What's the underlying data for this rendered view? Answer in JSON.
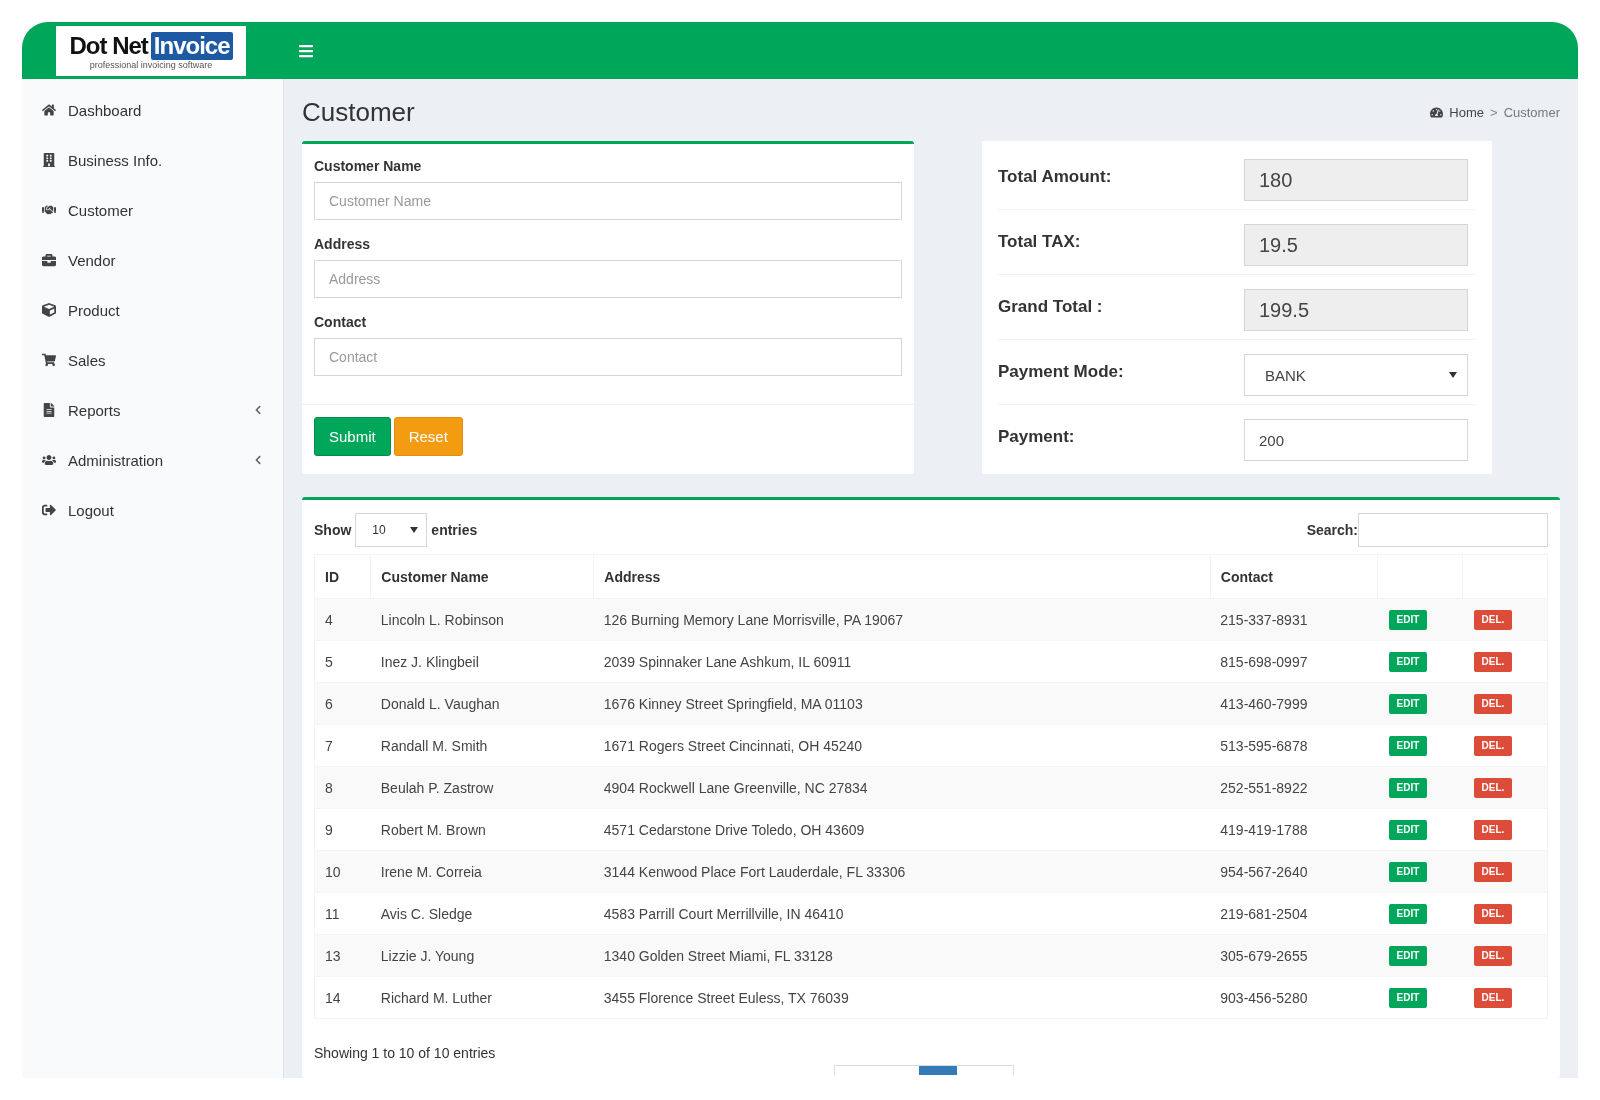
{
  "logo": {
    "brand": "Dot Net",
    "brand_highlight": "Invoice",
    "tagline": "professional invoicing software"
  },
  "sidebar": {
    "items": [
      {
        "label": "Dashboard",
        "submenu": false
      },
      {
        "label": "Business Info.",
        "submenu": false
      },
      {
        "label": "Customer",
        "submenu": false
      },
      {
        "label": "Vendor",
        "submenu": false
      },
      {
        "label": "Product",
        "submenu": false
      },
      {
        "label": "Sales",
        "submenu": false
      },
      {
        "label": "Reports",
        "submenu": true
      },
      {
        "label": "Administration",
        "submenu": true
      },
      {
        "label": "Logout",
        "submenu": false
      }
    ]
  },
  "page_title": "Customer",
  "breadcrumb": [
    "Home",
    "Customer"
  ],
  "breadcrumb_separator": ">",
  "form": {
    "fields": [
      {
        "label": "Customer Name",
        "placeholder": "Customer Name"
      },
      {
        "label": "Address",
        "placeholder": "Address"
      },
      {
        "label": "Contact",
        "placeholder": "Contact"
      }
    ],
    "buttons": [
      {
        "label": "Submit",
        "kind": "primary"
      },
      {
        "label": "Reset",
        "kind": "warning"
      }
    ]
  },
  "totals": [
    {
      "label": "Total Amount:",
      "kind": "readonly",
      "value": "180"
    },
    {
      "label": "Total TAX:",
      "kind": "readonly",
      "value": "19.5"
    },
    {
      "label": "Grand Total :",
      "kind": "readonly",
      "value": "199.5"
    },
    {
      "label": "Payment Mode:",
      "kind": "select",
      "value": "BANK"
    },
    {
      "label": "Payment:",
      "kind": "input",
      "value": "200"
    }
  ],
  "table": {
    "show_label": "Show",
    "page_size": "10",
    "entries_label": "entries",
    "search_label": "Search:",
    "columns": [
      "ID",
      "Customer Name",
      "Address",
      "Contact"
    ],
    "rows": [
      {
        "id": "4",
        "name": "Lincoln L. Robinson",
        "address": "126 Burning Memory Lane Morrisville, PA 19067",
        "contact": "215-337-8931",
        "edit": "EDIT",
        "delete": "DEL."
      },
      {
        "id": "5",
        "name": "Inez J. Klingbeil",
        "address": "2039 Spinnaker Lane Ashkum, IL 60911",
        "contact": "815-698-0997",
        "edit": "EDIT",
        "delete": "DEL."
      },
      {
        "id": "6",
        "name": "Donald L. Vaughan",
        "address": "1676 Kinney Street Springfield, MA 01103",
        "contact": "413-460-7999",
        "edit": "EDIT",
        "delete": "DEL."
      },
      {
        "id": "7",
        "name": "Randall M. Smith",
        "address": "1671 Rogers Street Cincinnati, OH 45240",
        "contact": "513-595-6878",
        "edit": "EDIT",
        "delete": "DEL."
      },
      {
        "id": "8",
        "name": "Beulah P. Zastrow",
        "address": "4904 Rockwell Lane Greenville, NC 27834",
        "contact": "252-551-8922",
        "edit": "EDIT",
        "delete": "DEL."
      },
      {
        "id": "9",
        "name": "Robert M. Brown",
        "address": "4571 Cedarstone Drive Toledo, OH 43609",
        "contact": "419-419-1788",
        "edit": "EDIT",
        "delete": "DEL."
      },
      {
        "id": "10",
        "name": "Irene M. Correia",
        "address": "3144 Kenwood Place Fort Lauderdale, FL 33306",
        "contact": "954-567-2640",
        "edit": "EDIT",
        "delete": "DEL."
      },
      {
        "id": "11",
        "name": "Avis C. Sledge",
        "address": "4583 Parrill Court Merrillville, IN 46410",
        "contact": "219-681-2504",
        "edit": "EDIT",
        "delete": "DEL."
      },
      {
        "id": "13",
        "name": "Lizzie J. Young",
        "address": "1340 Golden Street Miami, FL 33128",
        "contact": "305-679-2655",
        "edit": "EDIT",
        "delete": "DEL."
      },
      {
        "id": "14",
        "name": "Richard M. Luther",
        "address": "3455 Florence Street Euless, TX 76039",
        "contact": "903-456-5280",
        "edit": "EDIT",
        "delete": "DEL."
      }
    ],
    "footer": "Showing 1 to 10 of 10 entries"
  }
}
